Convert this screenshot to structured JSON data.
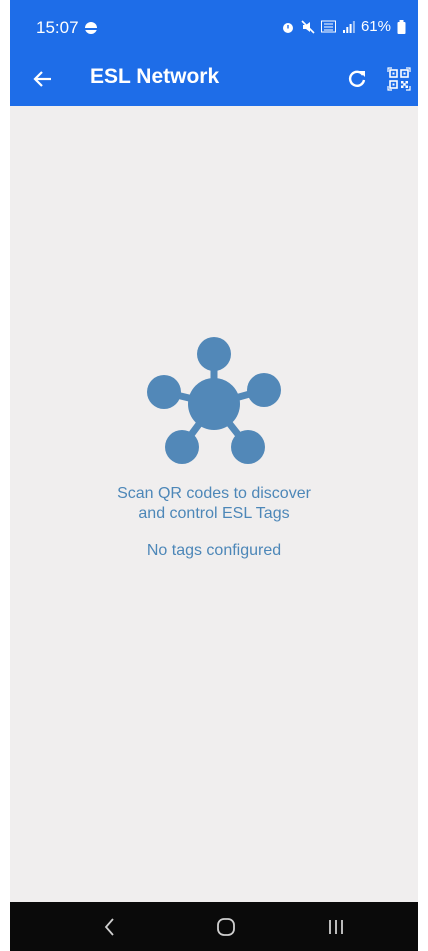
{
  "status_bar": {
    "time": "15:07",
    "battery": "61%",
    "icons": [
      "moon-icon",
      "alarm-icon",
      "mute-icon",
      "5g-icon",
      "signal-icon",
      "battery-icon"
    ]
  },
  "app_bar": {
    "title": "ESL Network",
    "back_icon": "arrow-left-icon",
    "refresh_icon": "refresh-icon",
    "scan_icon": "qr-scan-icon"
  },
  "empty_state": {
    "icon": "network-hub-icon",
    "message_line1": "Scan QR codes to discover",
    "message_line2": "and control ESL Tags",
    "status": "No tags configured"
  },
  "nav_bar": {
    "back_icon": "nav-back-icon",
    "home_icon": "nav-home-icon",
    "recents_icon": "nav-recents-icon"
  },
  "colors": {
    "primary": "#1e6de8",
    "background": "#f0eeee",
    "accent_text": "#4d87b8",
    "icon_fill": "#5288b8",
    "nav_bar": "#0a0a0a"
  }
}
